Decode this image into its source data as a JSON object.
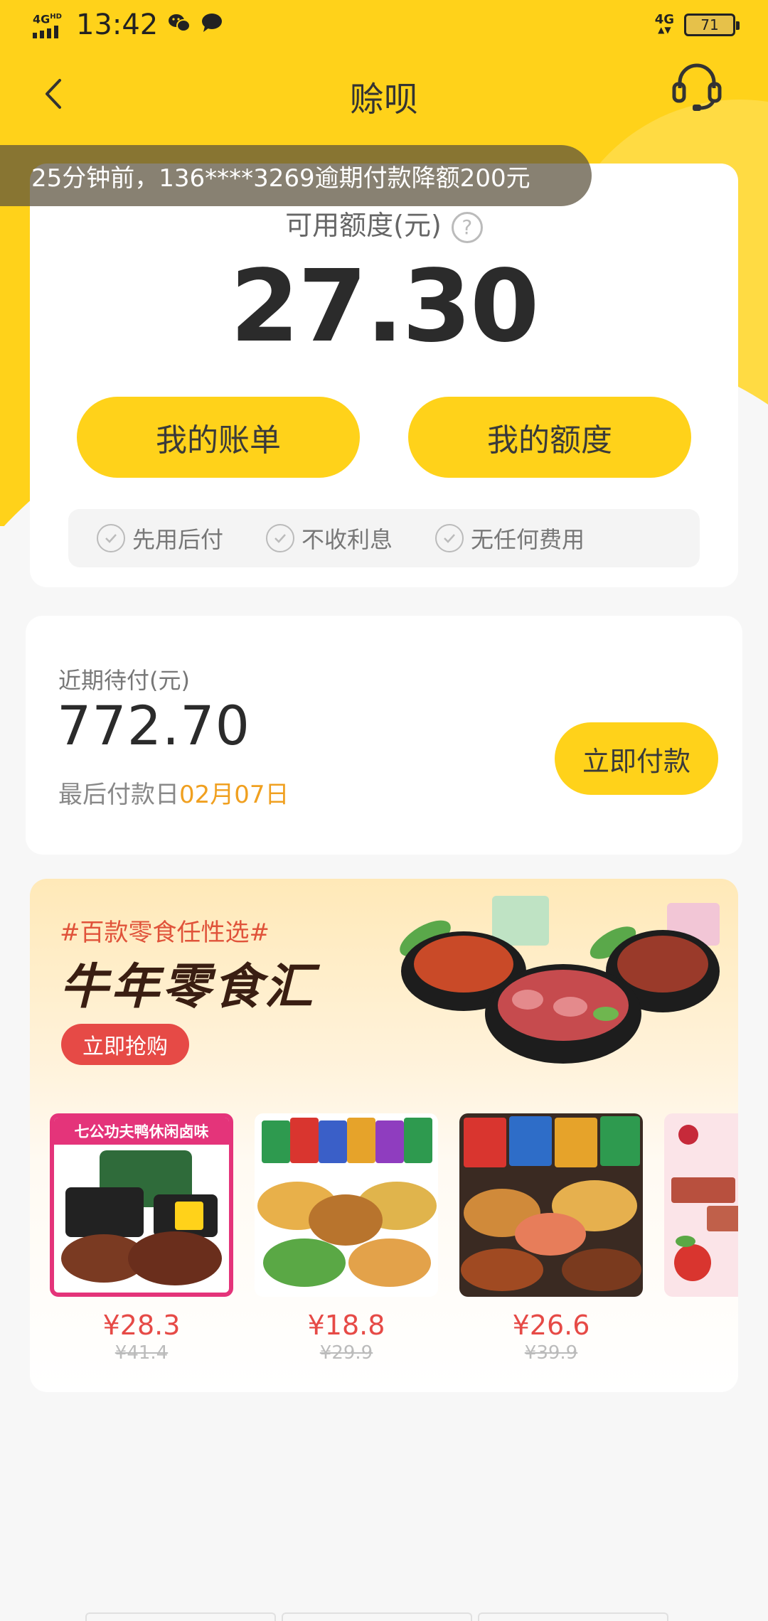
{
  "status_bar": {
    "network": "4G",
    "network_suffix": "HD",
    "time": "13:42",
    "network_right": "4G",
    "battery": "71"
  },
  "nav": {
    "title": "赊呗"
  },
  "ticker": {
    "text": "25分钟前，136****3269逾期付款降额200元"
  },
  "credit": {
    "label": "可用额度(元)",
    "help": "?",
    "amount": "27.30",
    "bill_button": "我的账单",
    "quota_button": "我的额度",
    "features": [
      "先用后付",
      "不收利息",
      "无任何费用"
    ]
  },
  "payment": {
    "label": "近期待付(元)",
    "amount": "772.70",
    "due_prefix": "最后付款日",
    "due_date": "02月07日",
    "pay_button": "立即付款"
  },
  "promo": {
    "tag": "#百款零食任性选#",
    "title": "牛年零食汇",
    "button": "立即抢购",
    "products": [
      {
        "banner": "七公功夫鸭休闲卤味",
        "price": "¥28.3",
        "original": "¥41.4"
      },
      {
        "price": "¥18.8",
        "original": "¥29.9"
      },
      {
        "price": "¥26.6",
        "original": "¥39.9"
      },
      {
        "price": "¥"
      }
    ]
  },
  "colors": {
    "brand_yellow": "#ffd21a",
    "accent_red": "#e64a46",
    "due_orange": "#f0a020"
  },
  "icons": {
    "back": "chevron-left-icon",
    "service": "headset-icon",
    "help": "question-circle-icon",
    "check": "check-circle-icon"
  }
}
